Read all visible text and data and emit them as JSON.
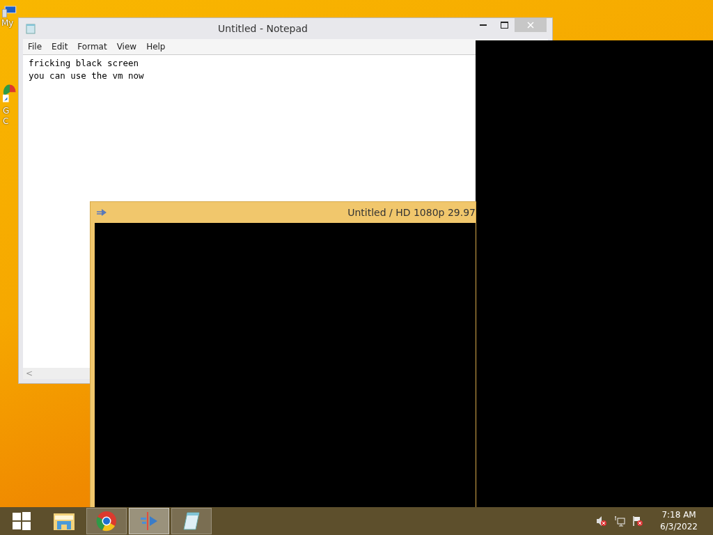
{
  "desktop_icons": [
    {
      "kind": "computer",
      "lines": [
        "My"
      ]
    },
    {
      "kind": "browser",
      "lines": [
        "G",
        "C"
      ]
    }
  ],
  "notepad": {
    "title": "Untitled - Notepad",
    "menu": [
      "File",
      "Edit",
      "Format",
      "View",
      "Help"
    ],
    "lines": [
      "fricking black screen",
      "you can use the vm now"
    ],
    "scroll_left": "<"
  },
  "video_window": {
    "title": "Untitled / HD 1080p 29.97"
  },
  "taskbar": {
    "items": [
      {
        "kind": "start",
        "selected": false
      },
      {
        "kind": "folder",
        "selected": false
      },
      {
        "kind": "browser",
        "selected": false,
        "open": true
      },
      {
        "kind": "video",
        "selected": true,
        "open": true
      },
      {
        "kind": "notepad",
        "selected": false,
        "open": true
      }
    ],
    "tray": [
      {
        "kind": "volume"
      },
      {
        "kind": "network"
      },
      {
        "kind": "flag"
      }
    ],
    "time": "7:18 AM",
    "date": "6/3/2022"
  }
}
